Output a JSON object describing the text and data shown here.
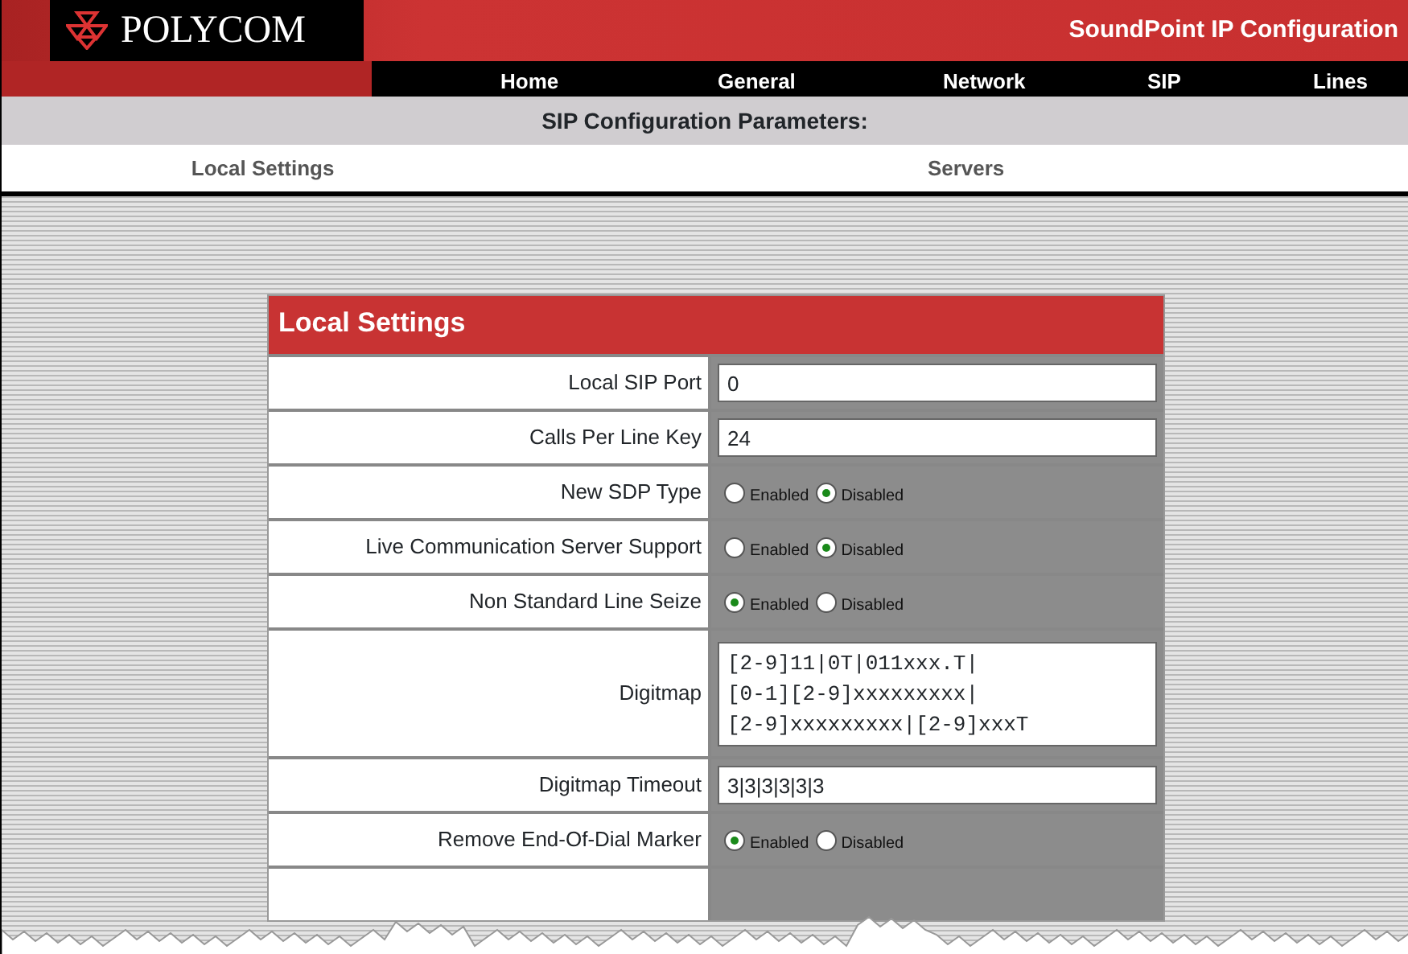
{
  "header": {
    "logo": "POLYCOM",
    "title": "SoundPoint IP Configuration"
  },
  "nav": [
    {
      "label": "Home"
    },
    {
      "label": "General"
    },
    {
      "label": "Network"
    },
    {
      "label": "SIP"
    },
    {
      "label": "Lines"
    }
  ],
  "section_title": "SIP Configuration Parameters:",
  "subtabs": [
    {
      "label": "Local Settings"
    },
    {
      "label": "Servers"
    }
  ],
  "panel": {
    "title": "Local Settings",
    "rows": [
      {
        "kind": "text",
        "label": "Local SIP Port",
        "value": "0"
      },
      {
        "kind": "text",
        "label": "Calls Per Line Key",
        "value": "24"
      },
      {
        "kind": "radio",
        "label": "New SDP Type",
        "options": [
          {
            "label": "Enabled",
            "selected": false
          },
          {
            "label": "Disabled",
            "selected": true
          }
        ]
      },
      {
        "kind": "radio",
        "label": "Live Communication Server Support",
        "options": [
          {
            "label": "Enabled",
            "selected": false
          },
          {
            "label": "Disabled",
            "selected": true
          }
        ]
      },
      {
        "kind": "radio",
        "label": "Non Standard Line Seize",
        "options": [
          {
            "label": "Enabled",
            "selected": true
          },
          {
            "label": "Disabled",
            "selected": false
          }
        ]
      },
      {
        "kind": "textarea",
        "label": "Digitmap",
        "lines": [
          "[2-9]11|0T|011xxx.T|",
          "[0-1][2-9]xxxxxxxxx|",
          "[2-9]xxxxxxxxx|[2-9]xxxT"
        ]
      },
      {
        "kind": "text",
        "label": "Digitmap Timeout",
        "value": "3|3|3|3|3|3"
      },
      {
        "kind": "radio",
        "label": "Remove End-Of-Dial Marker",
        "options": [
          {
            "label": "Enabled",
            "selected": true
          },
          {
            "label": "Disabled",
            "selected": false
          }
        ]
      }
    ]
  }
}
